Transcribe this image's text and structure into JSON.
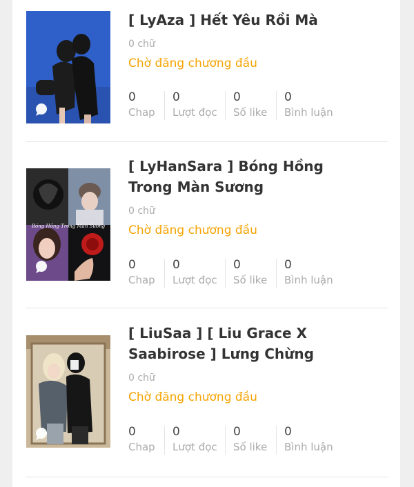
{
  "stories": [
    {
      "title": "[ LyAza ] Hết Yêu Rồi Mà",
      "words": "0 chữ",
      "status": "Chờ đăng chương đầu",
      "stats": [
        {
          "value": "0",
          "label": "Chap"
        },
        {
          "value": "0",
          "label": "Lượt đọc"
        },
        {
          "value": "0",
          "label": "Số like"
        },
        {
          "value": "0",
          "label": "Bình luận"
        }
      ]
    },
    {
      "title": "[ LyHanSara ] Bóng Hồng Trong Màn Sương",
      "words": "0 chữ",
      "status": "Chờ đăng chương đầu",
      "cover_caption": "Bóng Hồng Trong Màn Sương",
      "stats": [
        {
          "value": "0",
          "label": "Chap"
        },
        {
          "value": "0",
          "label": "Lượt đọc"
        },
        {
          "value": "0",
          "label": "Số like"
        },
        {
          "value": "0",
          "label": "Bình luận"
        }
      ]
    },
    {
      "title": "[ LiuSaa ] [ Liu Grace X Saabirose ] Lưng Chừng",
      "words": "0 chữ",
      "status": "Chờ đăng chương đầu",
      "stats": [
        {
          "value": "0",
          "label": "Chap"
        },
        {
          "value": "0",
          "label": "Lượt đọc"
        },
        {
          "value": "0",
          "label": "Số like"
        },
        {
          "value": "0",
          "label": "Bình luận"
        }
      ]
    }
  ],
  "colors": {
    "status": "#f5a300",
    "title": "#333333",
    "muted": "#aaaaaa",
    "background": "#efefef"
  },
  "icons": {
    "cover_badge": "chat-bubble-icon"
  }
}
